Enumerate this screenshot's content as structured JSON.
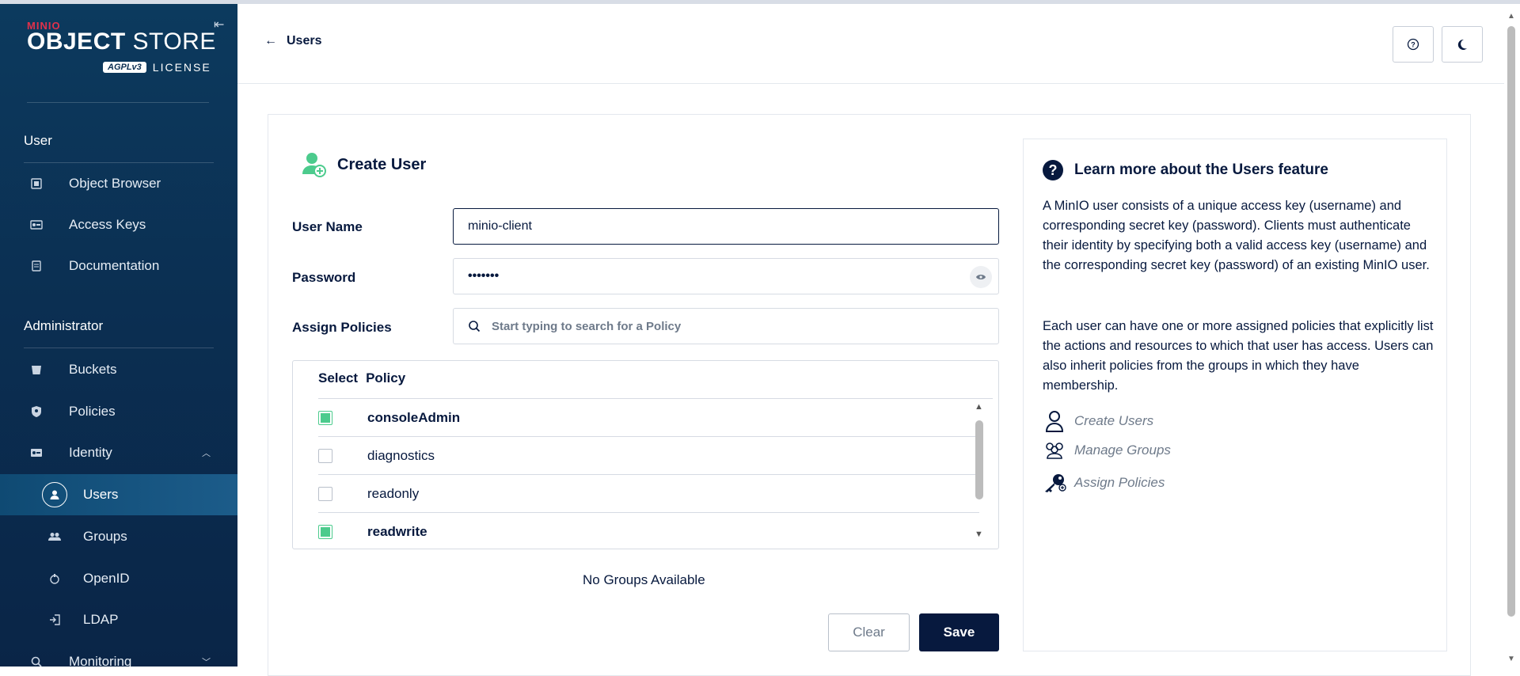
{
  "sidebar": {
    "logo": {
      "brand": "MINIO",
      "product_bold": "OBJECT",
      "product_light": "STORE",
      "badge": "AGPLv3",
      "license": "LICENSE"
    },
    "sections": [
      {
        "title": "User"
      },
      {
        "title": "Administrator"
      }
    ],
    "user_items": [
      {
        "label": "Object Browser",
        "icon": "object-browser-icon"
      },
      {
        "label": "Access Keys",
        "icon": "access-keys-icon"
      },
      {
        "label": "Documentation",
        "icon": "documentation-icon"
      }
    ],
    "admin_items": [
      {
        "label": "Buckets",
        "icon": "buckets-icon"
      },
      {
        "label": "Policies",
        "icon": "policies-icon"
      },
      {
        "label": "Identity",
        "icon": "identity-icon"
      },
      {
        "label": "Users",
        "icon": "user-icon"
      },
      {
        "label": "Groups",
        "icon": "groups-icon"
      },
      {
        "label": "OpenID",
        "icon": "openid-icon"
      },
      {
        "label": "LDAP",
        "icon": "ldap-icon"
      },
      {
        "label": "Monitoring",
        "icon": "monitoring-icon"
      }
    ]
  },
  "header": {
    "back_label": "Users"
  },
  "form": {
    "title": "Create User",
    "username_label": "User Name",
    "username_value": "minio-client",
    "password_label": "Password",
    "password_value": "•••••••",
    "policies_label": "Assign Policies",
    "policies_placeholder": "Start typing to search for a Policy",
    "table_headers": {
      "select": "Select",
      "policy": "Policy"
    },
    "policies": [
      {
        "name": "consoleAdmin",
        "checked": true
      },
      {
        "name": "diagnostics",
        "checked": false
      },
      {
        "name": "readonly",
        "checked": false
      },
      {
        "name": "readwrite",
        "checked": true
      }
    ],
    "no_groups": "No Groups Available",
    "clear_label": "Clear",
    "save_label": "Save"
  },
  "help": {
    "title": "Learn more about the Users feature",
    "p1": "A MinIO user consists of a unique access key (username) and corresponding secret key (password). Clients must authenticate their identity by specifying both a valid access key (username) and the corresponding secret key (password) of an existing MinIO user.",
    "p2": "Each user can have one or more assigned policies that explicitly list the actions and resources to which that user has access. Users can also inherit policies from the groups in which they have membership.",
    "links": [
      {
        "label": "Create Users",
        "icon": "user-outline-icon"
      },
      {
        "label": "Manage Groups",
        "icon": "groups-outline-icon"
      },
      {
        "label": "Assign Policies",
        "icon": "key-icon"
      }
    ]
  },
  "colors": {
    "navy": "#07193e",
    "accent_green": "#4ccb8d",
    "sidebar_bg": "#0b2f52"
  }
}
